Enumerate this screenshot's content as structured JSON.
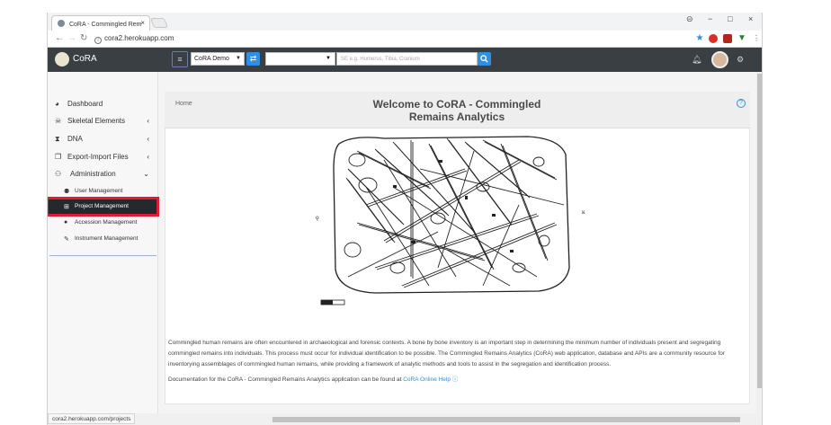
{
  "browser": {
    "tab_title": "CoRA - Commingled Rem",
    "tab_close": "×",
    "url": "cora2.herokuapp.com",
    "status_url": "cora2.herokuapp.com/projects",
    "min": "−",
    "max": "□",
    "close": "×",
    "account": "⊝"
  },
  "header": {
    "brand": "CoRA",
    "project_selected": "CoRA Demo",
    "category_selected": "",
    "search_placeholder": "SE e.g. Humerus, Tibia, Cranium",
    "colors": {
      "header_bg": "#3a3f44",
      "accent": "#2f8fe3"
    }
  },
  "sidebar": {
    "items": [
      {
        "label": "Dashboard",
        "icon": "dashboard-icon"
      },
      {
        "label": "Skeletal Elements",
        "icon": "skull-icon"
      },
      {
        "label": "DNA",
        "icon": "dna-icon"
      },
      {
        "label": "Export-Import Files",
        "icon": "files-icon"
      },
      {
        "label": "Administration",
        "icon": "users-cog-icon"
      }
    ],
    "subitems": [
      {
        "label": "User Management",
        "icon": "users-icon"
      },
      {
        "label": "Project Management",
        "icon": "sitemap-icon",
        "active": true
      },
      {
        "label": "Accession Management",
        "icon": "info-icon"
      },
      {
        "label": "Instrument Management",
        "icon": "wrench-icon"
      }
    ]
  },
  "main": {
    "breadcrumb": "Home",
    "title_line1": "Welcome to CoRA - Commingled",
    "title_line2": "Remains Analytics",
    "description": "Commingled human remains are often encountered in archaeological and forensic contexts. A bone by bone inventory is an important step in determining the minimum number of individuals present and segregating commingled remains into individuals. This process must occur for individual identification to be possible. The Commingled Remains Analytics (CoRA) web application, database and APIs are a community resource for inventorying assemblages of commingled human remains, while providing a framework of analytic methods and tools to assist in the segregation and identification process.",
    "doc_text": "Documentation for the CoRA - Commingled Remains Analytics application can be found at",
    "doc_link": "CoRA Online Help"
  }
}
